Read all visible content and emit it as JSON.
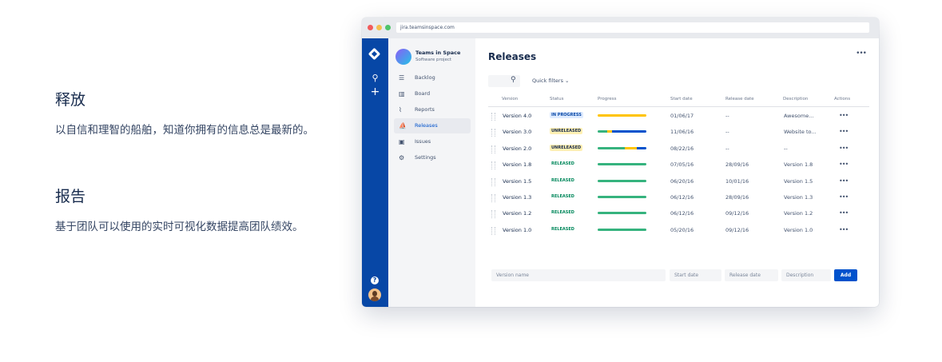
{
  "features": [
    {
      "title": "释放",
      "text": "以自信和理智的船舶，知道你拥有的信息总是最新的。"
    },
    {
      "title": "报告",
      "text": "基于团队可以使用的实时可视化数据提高团队绩效。"
    }
  ],
  "browser": {
    "url": "jira.teamsinspace.com"
  },
  "project": {
    "name": "Teams in Space",
    "type": "Software project"
  },
  "sidebar": {
    "items": [
      {
        "label": "Backlog",
        "icon": "backlog-icon",
        "active": false
      },
      {
        "label": "Board",
        "icon": "board-icon",
        "active": false
      },
      {
        "label": "Reports",
        "icon": "reports-icon",
        "active": false
      },
      {
        "label": "Releases",
        "icon": "releases-icon",
        "active": true
      },
      {
        "label": "Issues",
        "icon": "issues-icon",
        "active": false
      },
      {
        "label": "Settings",
        "icon": "settings-icon",
        "active": false
      }
    ]
  },
  "page": {
    "title": "Releases",
    "more": "•••",
    "quick_filters": "Quick filters ⌄"
  },
  "table": {
    "headers": [
      "Version",
      "Status",
      "Progress",
      "Start date",
      "Release date",
      "Description",
      "Actions"
    ],
    "rows": [
      {
        "version": "Version 4.0",
        "status": "IN PROGRESS",
        "start": "01/06/17",
        "release": "--",
        "description": "Awesome...",
        "progress": {
          "done": 0,
          "in_progress": 1.0,
          "todo": 0
        }
      },
      {
        "version": "Version 3.0",
        "status": "UNRELEASED",
        "start": "11/06/16",
        "release": "--",
        "description": "Website to...",
        "progress": {
          "done": 0.2,
          "in_progress": 0.1,
          "todo": 0.7
        }
      },
      {
        "version": "Version 2.0",
        "status": "UNRELEASED",
        "start": "08/22/16",
        "release": "--",
        "description": "--",
        "progress": {
          "done": 0.55,
          "in_progress": 0.25,
          "todo": 0.2
        }
      },
      {
        "version": "Version 1.8",
        "status": "RELEASED",
        "start": "07/05/16",
        "release": "28/09/16",
        "description": "Version 1.8",
        "progress": {
          "done": 1.0,
          "in_progress": 0,
          "todo": 0
        }
      },
      {
        "version": "Version 1.5",
        "status": "RELEASED",
        "start": "06/20/16",
        "release": "10/01/16",
        "description": "Version 1.5",
        "progress": {
          "done": 1.0,
          "in_progress": 0,
          "todo": 0
        }
      },
      {
        "version": "Version 1.3",
        "status": "RELEASED",
        "start": "06/12/16",
        "release": "28/09/16",
        "description": "Version 1.3",
        "progress": {
          "done": 1.0,
          "in_progress": 0,
          "todo": 0
        }
      },
      {
        "version": "Version 1.2",
        "status": "RELEASED",
        "start": "06/12/16",
        "release": "09/12/16",
        "description": "Version 1.2",
        "progress": {
          "done": 1.0,
          "in_progress": 0,
          "todo": 0
        }
      },
      {
        "version": "Version 1.0",
        "status": "RELEASED",
        "start": "05/20/16",
        "release": "09/12/16",
        "description": "Version 1.0",
        "progress": {
          "done": 1.0,
          "in_progress": 0,
          "todo": 0
        }
      }
    ],
    "actions_label": "•••"
  },
  "new_version": {
    "version_placeholder": "Version name",
    "start_placeholder": "Start date",
    "release_placeholder": "Release date",
    "description_placeholder": "Description",
    "add_label": "Add"
  },
  "colors": {
    "done": "#36b37e",
    "in_progress": "#ffc400",
    "todo": "#0052cc",
    "in_progress_lozenge_bg": "#deebff",
    "in_progress_lozenge_fg": "#0747a6",
    "unreleased_bg": "#fff0b3",
    "unreleased_fg": "#172b4d",
    "released_fg": "#00875a"
  }
}
